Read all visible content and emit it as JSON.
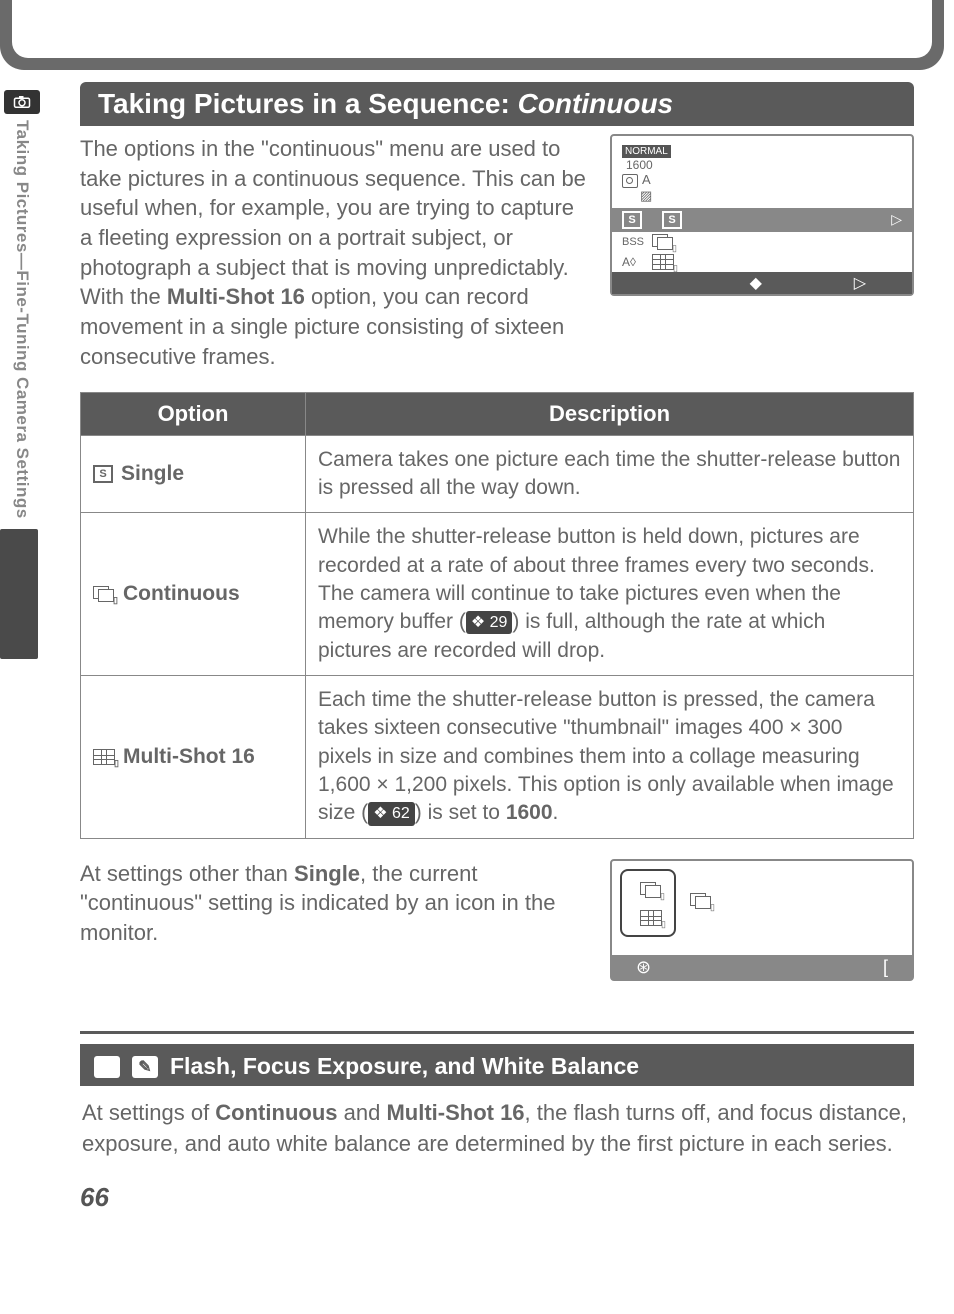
{
  "sideLabel": "Taking Pictures—Fine-Tuning Camera Settings",
  "title": {
    "pre": "Taking Pictures in a Sequence: ",
    "ital": "Continuous"
  },
  "intro": "The options in the \"continuous\" menu are used to take pictures in a continuous sequence.  This can be useful when, for example, you are trying to capture a fleeting expression on a portrait subject, or photograph a subject that is moving unpredictably.  With the ",
  "introBold": "Multi-Shot 16",
  "introAfter": " option, you can record movement in a single picture consisting of sixteen consecutive frames.",
  "lcd": {
    "normal": "NORMAL",
    "size": "1600",
    "a": "A",
    "s": "S",
    "bss": "BSS",
    "ao": "A◊"
  },
  "headers": {
    "opt": "Option",
    "desc": "Description"
  },
  "rows": {
    "single": {
      "label": "Single",
      "desc": "Camera takes one picture each time the shutter-release button is pressed all the way down."
    },
    "cont": {
      "label": "Continuous",
      "desc1": "While the shutter-release button is held down, pictures are recorded at a rate of about three frames every two seconds.  The camera will continue to take pictures even when the memory buffer (",
      "ref": "29",
      "desc2": ") is full, although the rate at which pictures are recorded will drop."
    },
    "multi": {
      "label": "Multi-Shot 16",
      "d1": "Each time the shutter-release button is pressed, the camera takes sixteen consecutive \"thumbnail\" images 400 × 300 pixels in size and combines them into a collage measuring 1,600 × 1,200 pixels.  This option is only available when image size (",
      "ref": "62",
      "d2": ") is set to ",
      "bold": "1600",
      "d3": "."
    }
  },
  "after": {
    "t1": "At settings other than ",
    "b": "Single",
    "t2": ", the current \"continuous\" setting is indicated by an icon in the monitor."
  },
  "note": {
    "title": "Flash, Focus Exposure, and White Balance",
    "b1": "At settings of ",
    "s1": "Continuous",
    "b2": " and ",
    "s2": "Multi-Shot 16",
    "b3": ", the flash turns off, and focus distance, exposure, and auto white balance are determined by the first picture in each series."
  },
  "miniBot": {
    "left": "⊛",
    "right": "["
  },
  "page": "66"
}
